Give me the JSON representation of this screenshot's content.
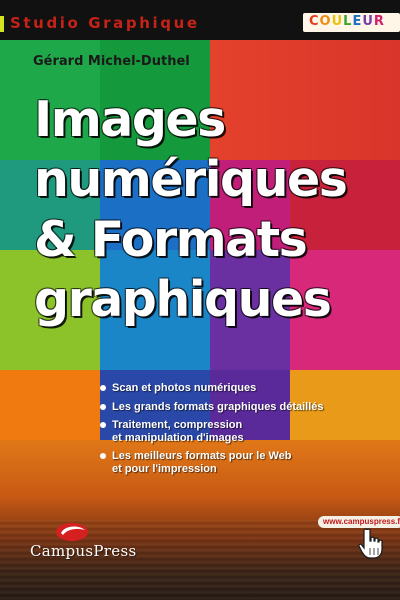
{
  "header": {
    "series": "Studio Graphique",
    "badge": "COULEUR",
    "badge_letter_colors": [
      "#e53a1a",
      "#f08c12",
      "#e8c20c",
      "#3aa42a",
      "#1b6fc4",
      "#7a3aa8",
      "#d11f6e"
    ]
  },
  "author": "Gérard Michel-Duthel",
  "title": {
    "line1": "Images",
    "line2": "numériques",
    "line3": "& Formats",
    "line4": "graphiques"
  },
  "bullets": [
    "Scan et photos numériques",
    "Les grands formats graphiques détaillés",
    "Traitement, compression\net manipulation d'images",
    "Les meilleurs formats pour le Web\net pour l'impression"
  ],
  "publisher": "CampusPress",
  "url": "www.campuspress.fr",
  "colors": {
    "header_bg": "#111111",
    "series_text": "#c62217",
    "url_text": "#c01818",
    "cursor_icon": "hand-pointer-icon"
  }
}
